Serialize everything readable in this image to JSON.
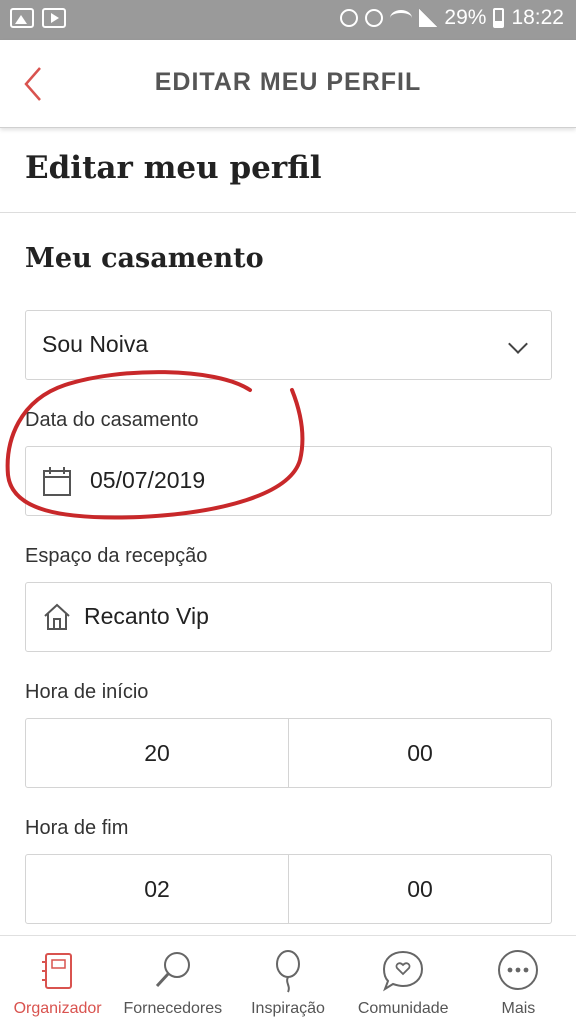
{
  "status_bar": {
    "battery": "29%",
    "time": "18:22"
  },
  "app_bar": {
    "title": "EDITAR MEU PERFIL"
  },
  "page": {
    "title": "Editar meu perfil",
    "section_title": "Meu casamento"
  },
  "form": {
    "role_select": {
      "value": "Sou Noiva"
    },
    "wedding_date": {
      "label": "Data do casamento",
      "value": "05/07/2019"
    },
    "reception": {
      "label": "Espaço da recepção",
      "value": "Recanto Vip"
    },
    "start_time": {
      "label": "Hora de início",
      "hours": "20",
      "minutes": "00"
    },
    "end_time": {
      "label": "Hora de fim",
      "hours": "02",
      "minutes": "00"
    }
  },
  "bottom_nav": {
    "items": [
      {
        "label": "Organizador",
        "icon": "notebook-icon",
        "active": true
      },
      {
        "label": "Fornecedores",
        "icon": "magnifier-icon",
        "active": false
      },
      {
        "label": "Inspiração",
        "icon": "balloon-icon",
        "active": false
      },
      {
        "label": "Comunidade",
        "icon": "chat-heart-icon",
        "active": false
      },
      {
        "label": "Mais",
        "icon": "more-dots-icon",
        "active": false
      }
    ]
  },
  "colors": {
    "accent": "#d9534f",
    "annotation": "#c8282a",
    "status_bar": "#9a9a9a"
  }
}
